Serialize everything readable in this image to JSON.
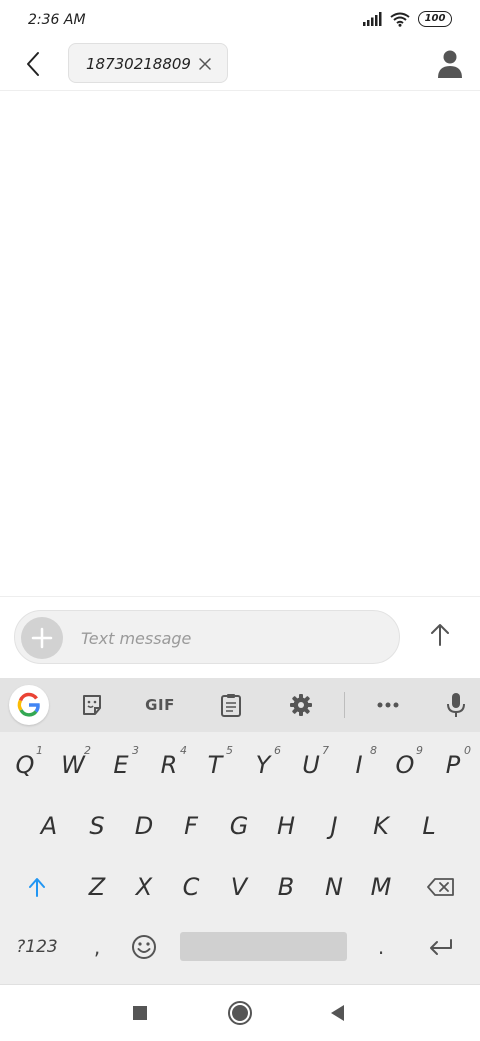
{
  "status_bar": {
    "time": "2:36 AM",
    "battery": "100"
  },
  "header": {
    "recipient": "18730218809"
  },
  "compose": {
    "placeholder": "Text message"
  },
  "keyboard": {
    "toolbar": {
      "gif_label": "GIF"
    },
    "row1": [
      {
        "label": "Q",
        "hint": "1"
      },
      {
        "label": "W",
        "hint": "2"
      },
      {
        "label": "E",
        "hint": "3"
      },
      {
        "label": "R",
        "hint": "4"
      },
      {
        "label": "T",
        "hint": "5"
      },
      {
        "label": "Y",
        "hint": "6"
      },
      {
        "label": "U",
        "hint": "7"
      },
      {
        "label": "I",
        "hint": "8"
      },
      {
        "label": "O",
        "hint": "9"
      },
      {
        "label": "P",
        "hint": "0"
      }
    ],
    "row2": [
      "A",
      "S",
      "D",
      "F",
      "G",
      "H",
      "J",
      "K",
      "L"
    ],
    "row3": [
      "Z",
      "X",
      "C",
      "V",
      "B",
      "N",
      "M"
    ],
    "symbols_label": "?123",
    "comma_label": ",",
    "period_label": "."
  },
  "colors": {
    "accent": "#2196f3",
    "keyboard_bg": "#eeeeee"
  }
}
